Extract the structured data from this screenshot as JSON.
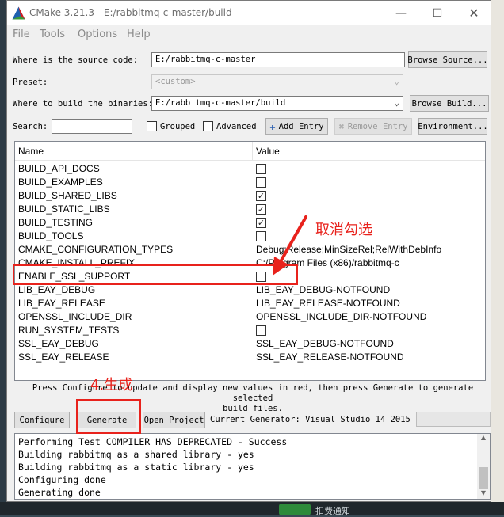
{
  "window": {
    "title": "CMake 3.21.3 - E:/rabbitmq-c-master/build",
    "controls": {
      "minimize": "—",
      "maximize": "☐",
      "close": "✕"
    }
  },
  "menu": [
    "File",
    "Tools",
    "Options",
    "Help"
  ],
  "source": {
    "label": "Where is the source code:",
    "value": "E:/rabbitmq-c-master",
    "button": "Browse Source..."
  },
  "preset": {
    "label": "Preset:",
    "value": "<custom>"
  },
  "build": {
    "label": "Where to build the binaries:",
    "value": "E:/rabbitmq-c-master/build",
    "button": "Browse Build..."
  },
  "search": {
    "label": "Search:",
    "value": ""
  },
  "options": {
    "grouped": {
      "label": "Grouped",
      "checked": false
    },
    "advanced": {
      "label": "Advanced",
      "checked": false
    },
    "add_entry": "Add Entry",
    "remove_entry": "Remove Entry",
    "environment": "Environment..."
  },
  "table": {
    "headers": {
      "name": "Name",
      "value": "Value"
    },
    "rows": [
      {
        "name": "BUILD_API_DOCS",
        "type": "bool",
        "checked": false
      },
      {
        "name": "BUILD_EXAMPLES",
        "type": "bool",
        "checked": false
      },
      {
        "name": "BUILD_SHARED_LIBS",
        "type": "bool",
        "checked": true
      },
      {
        "name": "BUILD_STATIC_LIBS",
        "type": "bool",
        "checked": true
      },
      {
        "name": "BUILD_TESTING",
        "type": "bool",
        "checked": true
      },
      {
        "name": "BUILD_TOOLS",
        "type": "bool",
        "checked": false
      },
      {
        "name": "CMAKE_CONFIGURATION_TYPES",
        "type": "text",
        "value": "Debug;Release;MinSizeRel;RelWithDebInfo"
      },
      {
        "name": "CMAKE_INSTALL_PREFIX",
        "type": "text",
        "value": "C:/Program Files (x86)/rabbitmq-c"
      },
      {
        "name": "ENABLE_SSL_SUPPORT",
        "type": "bool",
        "checked": false
      },
      {
        "name": "LIB_EAY_DEBUG",
        "type": "text",
        "value": "LIB_EAY_DEBUG-NOTFOUND"
      },
      {
        "name": "LIB_EAY_RELEASE",
        "type": "text",
        "value": "LIB_EAY_RELEASE-NOTFOUND"
      },
      {
        "name": "OPENSSL_INCLUDE_DIR",
        "type": "text",
        "value": "OPENSSL_INCLUDE_DIR-NOTFOUND"
      },
      {
        "name": "RUN_SYSTEM_TESTS",
        "type": "bool",
        "checked": false
      },
      {
        "name": "SSL_EAY_DEBUG",
        "type": "text",
        "value": "SSL_EAY_DEBUG-NOTFOUND"
      },
      {
        "name": "SSL_EAY_RELEASE",
        "type": "text",
        "value": "SSL_EAY_RELEASE-NOTFOUND"
      }
    ]
  },
  "hint": {
    "line1": "Press Configure to update and display new values in red, then press Generate to generate selected",
    "line2": "build files."
  },
  "actions": {
    "configure": "Configure",
    "generate": "Generate",
    "open_project": "Open Project"
  },
  "generator": {
    "label": "Current Generator:",
    "value": "Visual Studio 14 2015"
  },
  "output": [
    "Performing Test COMPILER_HAS_DEPRECATED - Success",
    "Building rabbitmq as a shared library - yes",
    "Building rabbitmq as a static library - yes",
    "Configuring done",
    "Generating done"
  ],
  "annotations": {
    "uncheck": "取消勾选",
    "generate": "4.生成"
  },
  "background": {
    "taskbar_text": "扣费通知"
  },
  "colors": {
    "annotation": "#e8221c"
  }
}
